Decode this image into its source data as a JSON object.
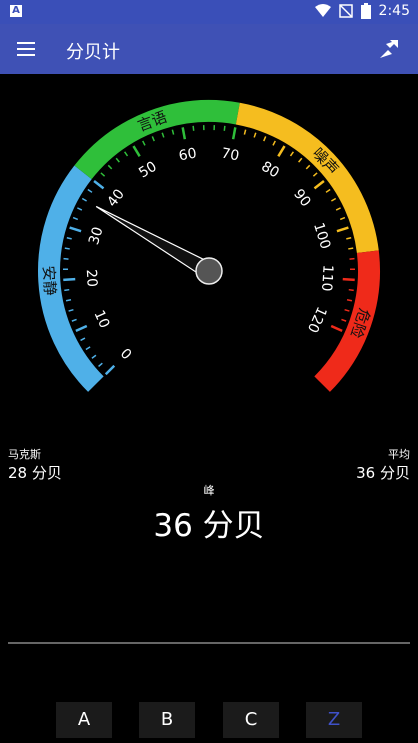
{
  "status_bar": {
    "time": "2:45",
    "app_badge": "A"
  },
  "app_bar": {
    "title": "分贝计"
  },
  "gauge": {
    "zones": [
      {
        "label": "安静",
        "from": 0,
        "to": 40,
        "color": "#4fb0e8"
      },
      {
        "label": "言语",
        "from": 40,
        "to": 70,
        "color": "#2fbf3a"
      },
      {
        "label": "噪声",
        "from": 70,
        "to": 105,
        "color": "#f5bd1f"
      },
      {
        "label": "危险",
        "from": 105,
        "to": 130,
        "color": "#ef2a1a"
      }
    ],
    "tick_labels": [
      "0",
      "10",
      "20",
      "30",
      "40",
      "50",
      "60",
      "70",
      "80",
      "90",
      "100",
      "110",
      "120"
    ],
    "needle_value": 36
  },
  "stats": {
    "max_label": "马克斯",
    "max_value": "28 分贝",
    "avg_label": "平均",
    "avg_value": "36 分贝",
    "peak_label": "峰",
    "peak_value": "36 分贝"
  },
  "weighting": {
    "buttons": [
      "A",
      "B",
      "C",
      "Z"
    ],
    "selected": "Z"
  }
}
